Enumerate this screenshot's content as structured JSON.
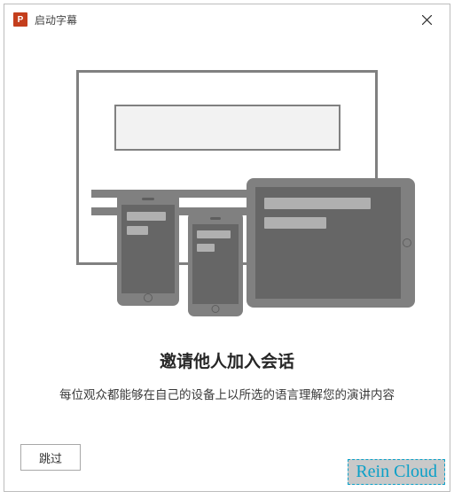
{
  "titlebar": {
    "app_icon_label": "P",
    "title": "启动字幕"
  },
  "main": {
    "heading": "邀请他人加入会话",
    "subtext": "每位观众都能够在自己的设备上以所选的语言理解您的演讲内容"
  },
  "footer": {
    "skip_label": "跳过"
  },
  "watermark": "Rein Cloud"
}
